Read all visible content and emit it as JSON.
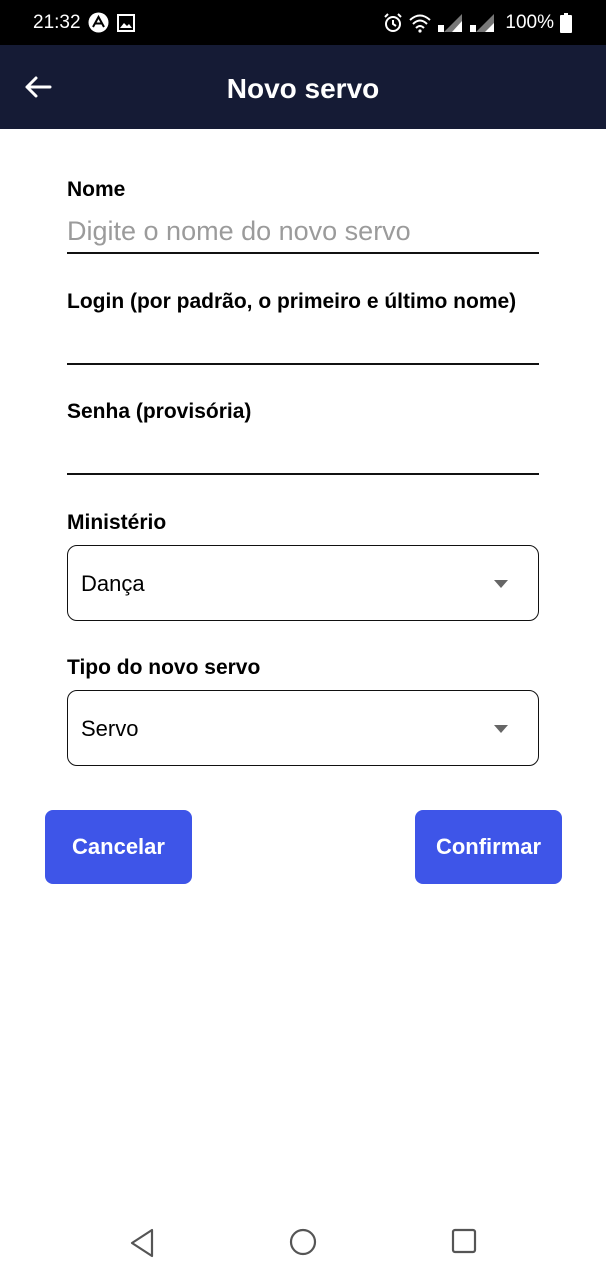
{
  "status_bar": {
    "time": "21:32",
    "battery": "100%",
    "icons": [
      "app-notification-icon",
      "image-icon",
      "alarm-icon",
      "wifi-icon",
      "signal-icon",
      "signal-icon",
      "battery-icon"
    ]
  },
  "app_bar": {
    "title": "Novo servo",
    "back_icon": "arrow-left-icon",
    "background": "#151b35"
  },
  "form": {
    "name": {
      "label": "Nome",
      "value": "",
      "placeholder": "Digite o nome do novo servo"
    },
    "login": {
      "label": "Login (por padrão, o primeiro e último nome)",
      "value": ""
    },
    "password": {
      "label": "Senha (provisória)",
      "value": ""
    },
    "ministry": {
      "label": "Ministério",
      "selected": "Dança"
    },
    "type": {
      "label": "Tipo do novo servo",
      "selected": "Servo"
    }
  },
  "actions": {
    "cancel_label": "Cancelar",
    "confirm_label": "Confirmar",
    "color": "#3e55e8"
  },
  "nav_bar": {
    "icons": [
      "back-triangle-icon",
      "home-circle-icon",
      "recents-square-icon"
    ]
  }
}
